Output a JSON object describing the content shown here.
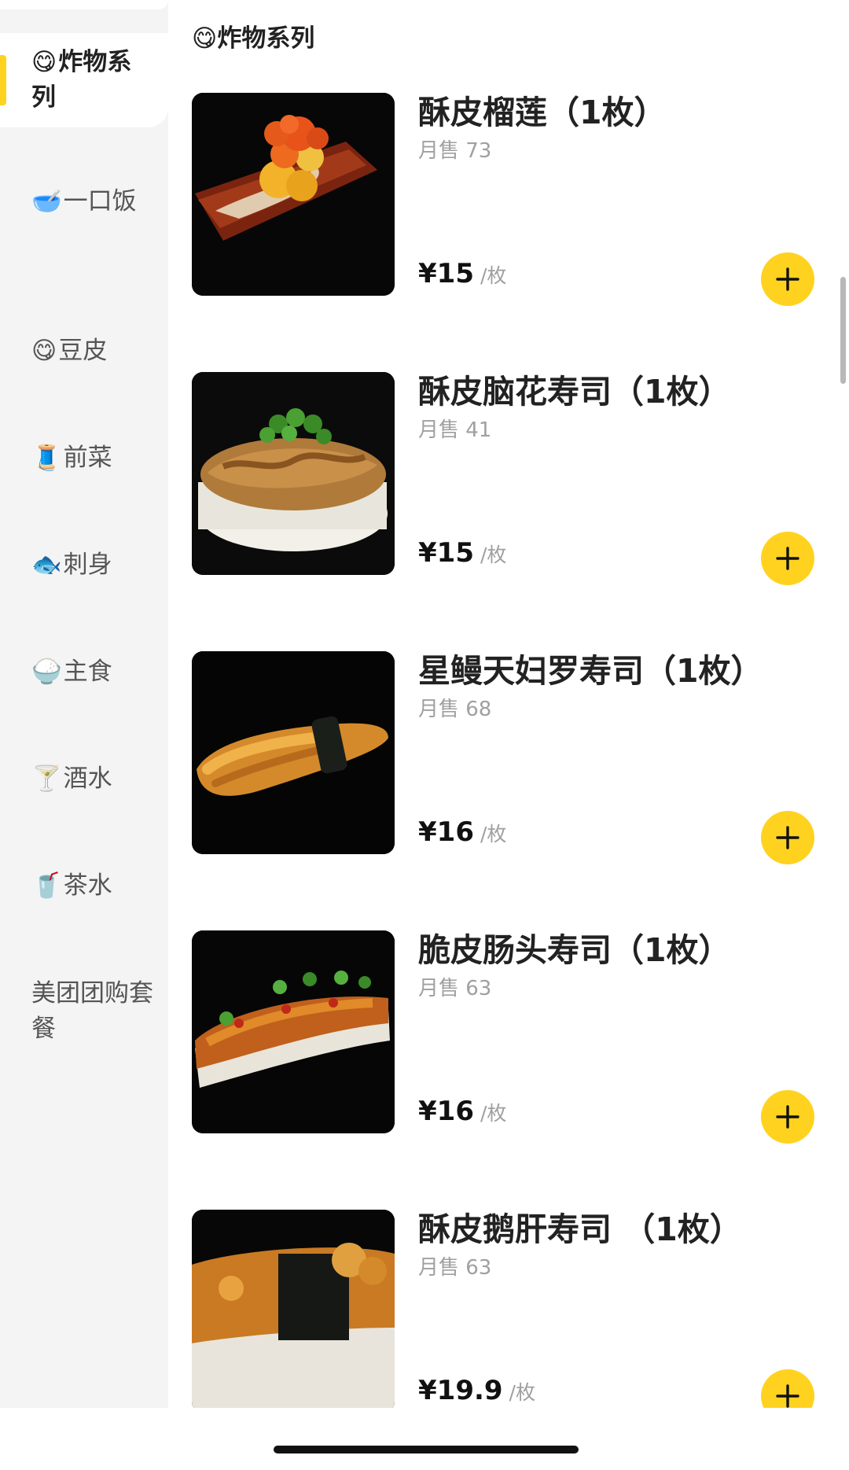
{
  "sidebar": {
    "categories": [
      {
        "emoji": "😋",
        "label": "炸物系列"
      },
      {
        "emoji": "🥣",
        "label": "一口饭"
      },
      {
        "emoji": "😋",
        "label": "豆皮"
      },
      {
        "emoji": "🧵",
        "label": "前菜"
      },
      {
        "emoji": "🐟",
        "label": "刺身"
      },
      {
        "emoji": "🍚",
        "label": "主食"
      },
      {
        "emoji": "🍸",
        "label": "酒水"
      },
      {
        "emoji": "🥤",
        "label": "茶水"
      },
      {
        "emoji": "",
        "label": "美团团购套餐"
      }
    ],
    "active_index": 0
  },
  "section": {
    "emoji": "😋",
    "title": "炸物系列"
  },
  "items": [
    {
      "name": "酥皮榴莲（1枚）",
      "sales": "月售 73",
      "price": "¥15",
      "unit": "/枚"
    },
    {
      "name": "酥皮脑花寿司（1枚）",
      "sales": "月售 41",
      "price": "¥15",
      "unit": "/枚"
    },
    {
      "name": "星鳗天妇罗寿司（1枚）",
      "sales": "月售 68",
      "price": "¥16",
      "unit": "/枚"
    },
    {
      "name": "脆皮肠头寿司（1枚）",
      "sales": "月售 63",
      "price": "¥16",
      "unit": "/枚"
    },
    {
      "name": "酥皮鹅肝寿司 （1枚）",
      "sales": "月售 63",
      "price": "¥19.9",
      "unit": "/枚"
    }
  ],
  "colors": {
    "accent": "#ffd21f",
    "sidebar_bg": "#f4f4f4",
    "muted_text": "#a0a0a0"
  },
  "icons": {
    "add": "plus-icon"
  }
}
